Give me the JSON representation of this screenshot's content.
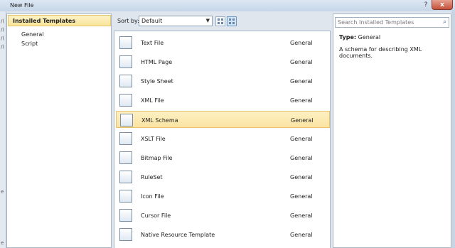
{
  "window": {
    "title": "New File",
    "help": "?",
    "close": "x"
  },
  "edge_glyphs": [
    "/(",
    "/(",
    "/(",
    "/(",
    "e",
    "e"
  ],
  "left": {
    "header": "Installed Templates",
    "items": [
      "General",
      "Script"
    ]
  },
  "toolbar": {
    "sort_label": "Sort by:",
    "sort_value": "Default"
  },
  "templates": [
    {
      "name": "Text File",
      "category": "General",
      "icon": "text-file-icon"
    },
    {
      "name": "HTML Page",
      "category": "General",
      "icon": "html-page-icon"
    },
    {
      "name": "Style Sheet",
      "category": "General",
      "icon": "style-sheet-icon"
    },
    {
      "name": "XML File",
      "category": "General",
      "icon": "xml-file-icon"
    },
    {
      "name": "XML Schema",
      "category": "General",
      "icon": "xml-schema-icon",
      "selected": true
    },
    {
      "name": "XSLT File",
      "category": "General",
      "icon": "xslt-file-icon"
    },
    {
      "name": "Bitmap File",
      "category": "General",
      "icon": "bitmap-file-icon"
    },
    {
      "name": "RuleSet",
      "category": "General",
      "icon": "ruleset-icon"
    },
    {
      "name": "Icon File",
      "category": "General",
      "icon": "icon-file-icon"
    },
    {
      "name": "Cursor File",
      "category": "General",
      "icon": "cursor-file-icon"
    },
    {
      "name": "Native Resource Template",
      "category": "General",
      "icon": "native-resource-icon"
    }
  ],
  "details": {
    "search_placeholder": "Search Installed Templates",
    "type_label": "Type:",
    "type_value": "General",
    "description": "A schema for describing XML documents."
  },
  "colors": {
    "selection": "#fbe4a2",
    "accent": "#e8c36a"
  }
}
